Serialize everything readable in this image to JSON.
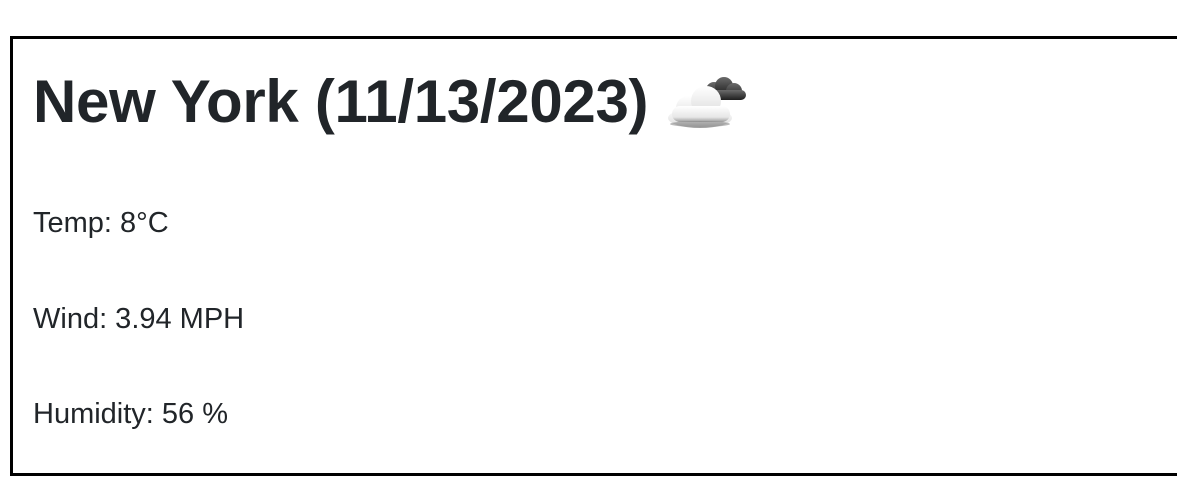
{
  "forecast": {
    "city": "New York",
    "date": "(11/13/2023)",
    "title": "New York (11/13/2023)",
    "icon": "partly-cloudy-icon",
    "temp": "Temp: 8°C",
    "wind": "Wind: 3.94 MPH",
    "humidity": "Humidity: 56 %"
  },
  "colors": {
    "text": "#212529",
    "border": "#000000",
    "background": "#ffffff"
  }
}
